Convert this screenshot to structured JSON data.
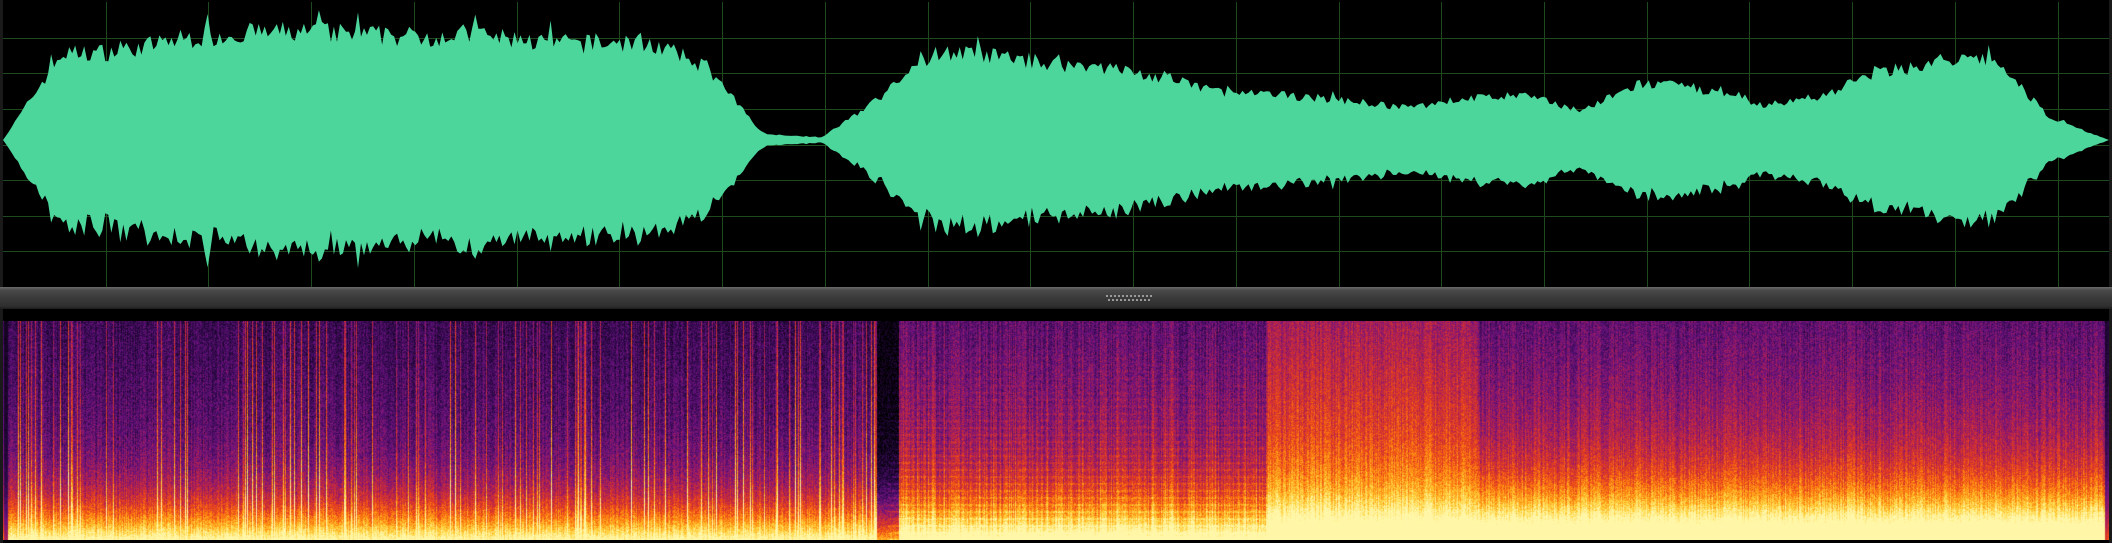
{
  "app": {
    "view": "waveform-and-spectrogram",
    "colors": {
      "waveform_fill": "#4cd69b",
      "waveform_grid": "#1f4a1f",
      "waveform_background": "#000000",
      "spectrogram_palette": [
        "#000000",
        "#2a0845",
        "#6a1280",
        "#b3214f",
        "#e8411c",
        "#ff8a10",
        "#ffd23a",
        "#fff6a8"
      ],
      "splitter": "#3a3a3a"
    }
  },
  "waveform": {
    "grid": true,
    "envelope": [
      0,
      0.7,
      0.72,
      0.82,
      0.86,
      0.88,
      0.86,
      0.84,
      0.86,
      0.8,
      0.78,
      0.8,
      0.6,
      0.05,
      0.02,
      0.35,
      0.72,
      0.68,
      0.62,
      0.58,
      0.48,
      0.38,
      0.36,
      0.32,
      0.26,
      0.34,
      0.36,
      0.24,
      0.46,
      0.42,
      0.28,
      0.34,
      0.55,
      0.62,
      0.66,
      0.18,
      0.0
    ]
  },
  "spectrogram": {
    "segments": [
      {
        "from": 0.0,
        "to": 0.42,
        "character": "percussive"
      },
      {
        "from": 0.42,
        "to": 0.6,
        "character": "harmonic"
      },
      {
        "from": 0.6,
        "to": 0.7,
        "character": "dense-noise"
      },
      {
        "from": 0.7,
        "to": 1.0,
        "character": "broadband"
      }
    ]
  },
  "splitter": {
    "grip_icon": "drag-handle-icon"
  }
}
